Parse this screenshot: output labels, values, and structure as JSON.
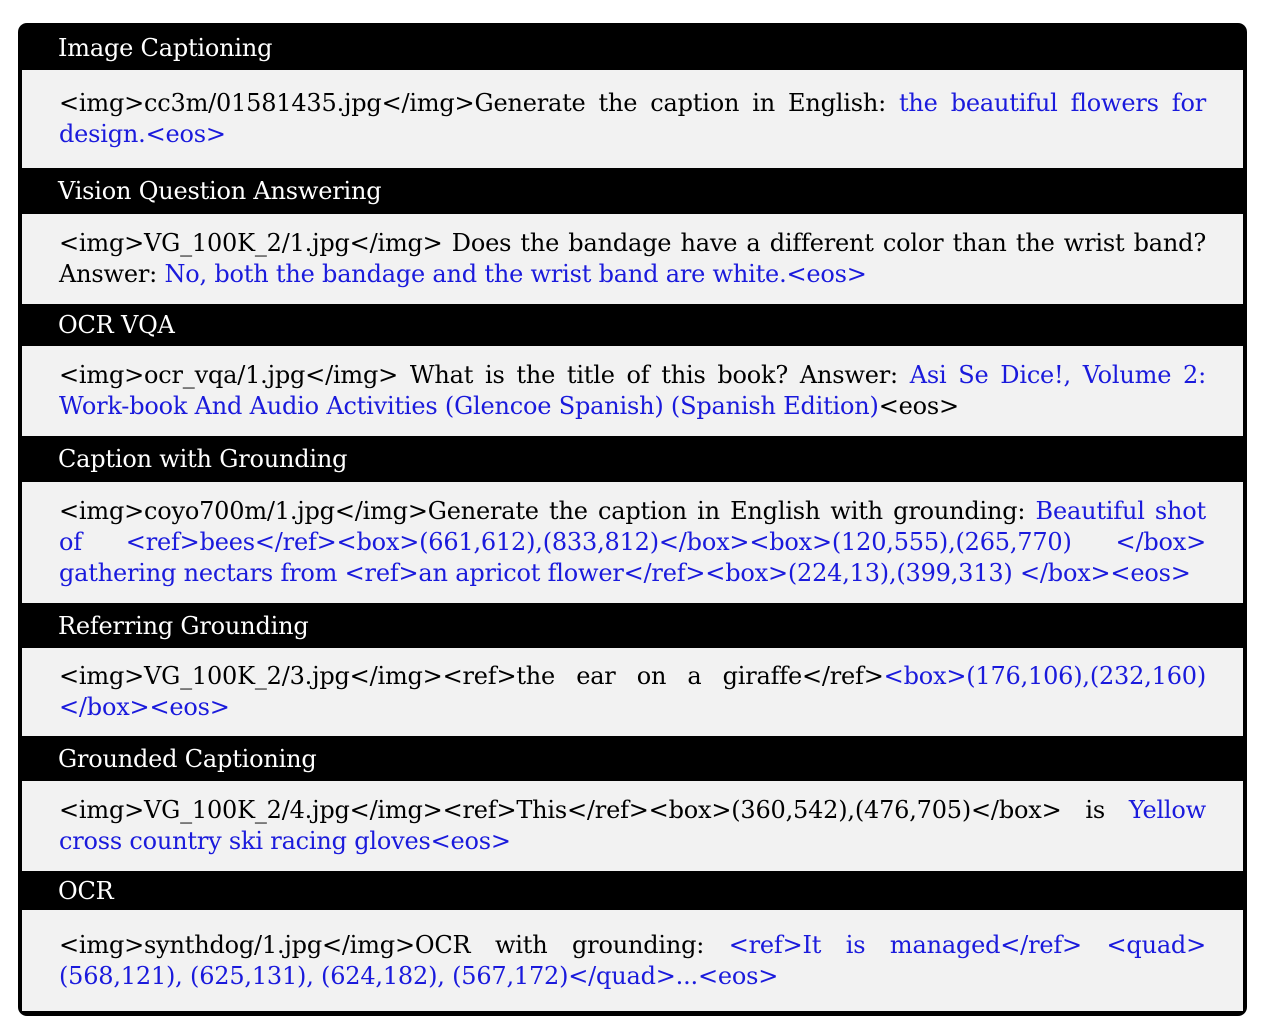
{
  "sections": [
    {
      "title": "Image Captioning",
      "prompt": "<img>cc3m/01581435.jpg</img>Generate the caption in English: ",
      "answer": "the beautiful flowers for design.<eos>",
      "tail": ""
    },
    {
      "title": "Vision Question Answering",
      "prompt": "<img>VG_100K_2/1.jpg</img> Does the bandage have a different color than the wrist band? Answer: ",
      "answer": "No, both the bandage and the wrist band are white.<eos>",
      "tail": ""
    },
    {
      "title": "OCR VQA",
      "prompt": "<img>ocr_vqa/1.jpg</img> What is the title of this book? Answer: ",
      "answer": "Asi Se Dice!, Volume 2: Work-book And Audio Activities (Glencoe Spanish) (Spanish Edition)",
      "tail": "<eos>"
    },
    {
      "title": "Caption with Grounding",
      "prompt": "<img>coyo700m/1.jpg</img>Generate the caption in English with grounding: ",
      "answer": "Beautiful shot of <ref>bees</ref><box>(661,612),(833,812)</box><box>(120,555),(265,770) </box> gathering nectars from <ref>an apricot flower</ref><box>(224,13),(399,313) </box><eos>",
      "tail": ""
    },
    {
      "title": "Referring Grounding",
      "prompt": "<img>VG_100K_2/3.jpg</img><ref>the ear on a giraffe</ref>",
      "answer": "<box>(176,106),(232,160) </box><eos>",
      "tail": ""
    },
    {
      "title": "Grounded Captioning",
      "prompt": "<img>VG_100K_2/4.jpg</img><ref>This</ref><box>(360,542),(476,705)</box> is ",
      "answer": "Yellow cross country ski racing gloves<eos>",
      "tail": ""
    },
    {
      "title": "OCR",
      "prompt": "<img>synthdog/1.jpg</img>OCR with grounding: ",
      "answer": "<ref>It is managed</ref> <quad> (568,121), (625,131), (624,182), (567,172)</quad>...<eos>",
      "tail": ""
    }
  ],
  "colors": {
    "header_bg": "#000000",
    "header_text": "#ffffff",
    "body_bg": "#f2f2f2",
    "answer_text": "#1a1adc"
  }
}
